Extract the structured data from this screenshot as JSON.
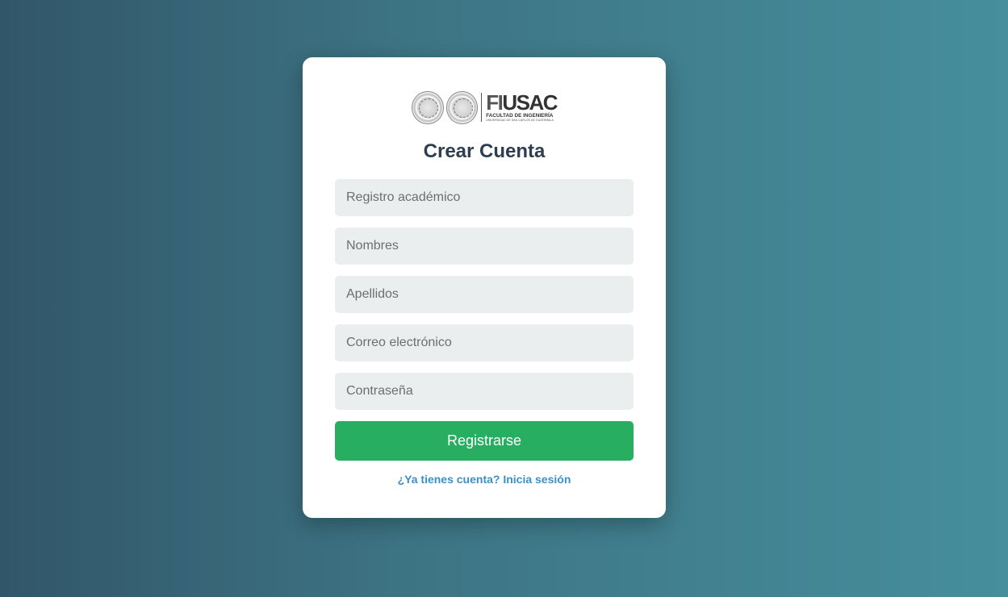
{
  "logo": {
    "brand": "FIUSAC",
    "brand_prefix": "FI",
    "brand_suffix": "USAC",
    "subtitle": "FACULTAD DE INGENIERÍA",
    "subtitle2": "UNIVERSIDAD DE SAN CARLOS DE GUATEMALA"
  },
  "form": {
    "title": "Crear Cuenta",
    "fields": {
      "registro": {
        "placeholder": "Registro académico",
        "value": ""
      },
      "nombres": {
        "placeholder": "Nombres",
        "value": ""
      },
      "apellidos": {
        "placeholder": "Apellidos",
        "value": ""
      },
      "correo": {
        "placeholder": "Correo electrónico",
        "value": ""
      },
      "contrasena": {
        "placeholder": "Contraseña",
        "value": ""
      }
    },
    "submit_label": "Registrarse",
    "login_link": "¿Ya tienes cuenta? Inicia sesión"
  },
  "colors": {
    "primary_button": "#27ae60",
    "link": "#3d8fc6",
    "title": "#2c3e50",
    "background_start": "#315669",
    "background_end": "#468e9c"
  }
}
